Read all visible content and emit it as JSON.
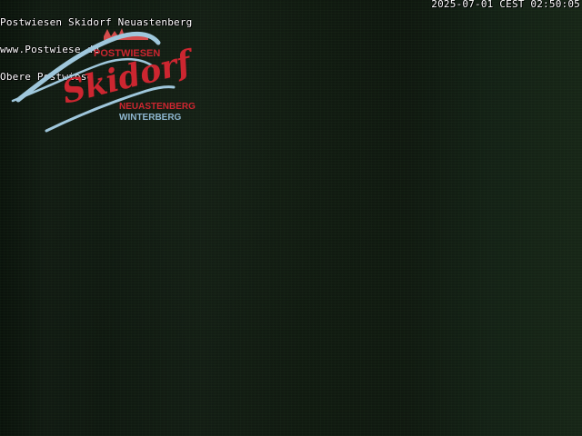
{
  "overlay": {
    "line1": "Postwiesen Skidorf Neuastenberg",
    "line2": "www.Postwiese.de",
    "line3": "Obere Postwiese",
    "timestamp": "2025-07-01 CEST 02:50:05"
  },
  "logo": {
    "top_text": "POSTWIESEN",
    "main_text": "Skidorf",
    "subtitle1": "NEUASTENBERG",
    "subtitle2": "WINTERBERG"
  },
  "colors": {
    "brand_red": "#cc2630",
    "brand_blue": "#8fb8d1",
    "overlay_text": "#ffffff",
    "scene_background": "#101910"
  },
  "icons": {
    "logo_icon": "skidorf-logo-icon"
  }
}
